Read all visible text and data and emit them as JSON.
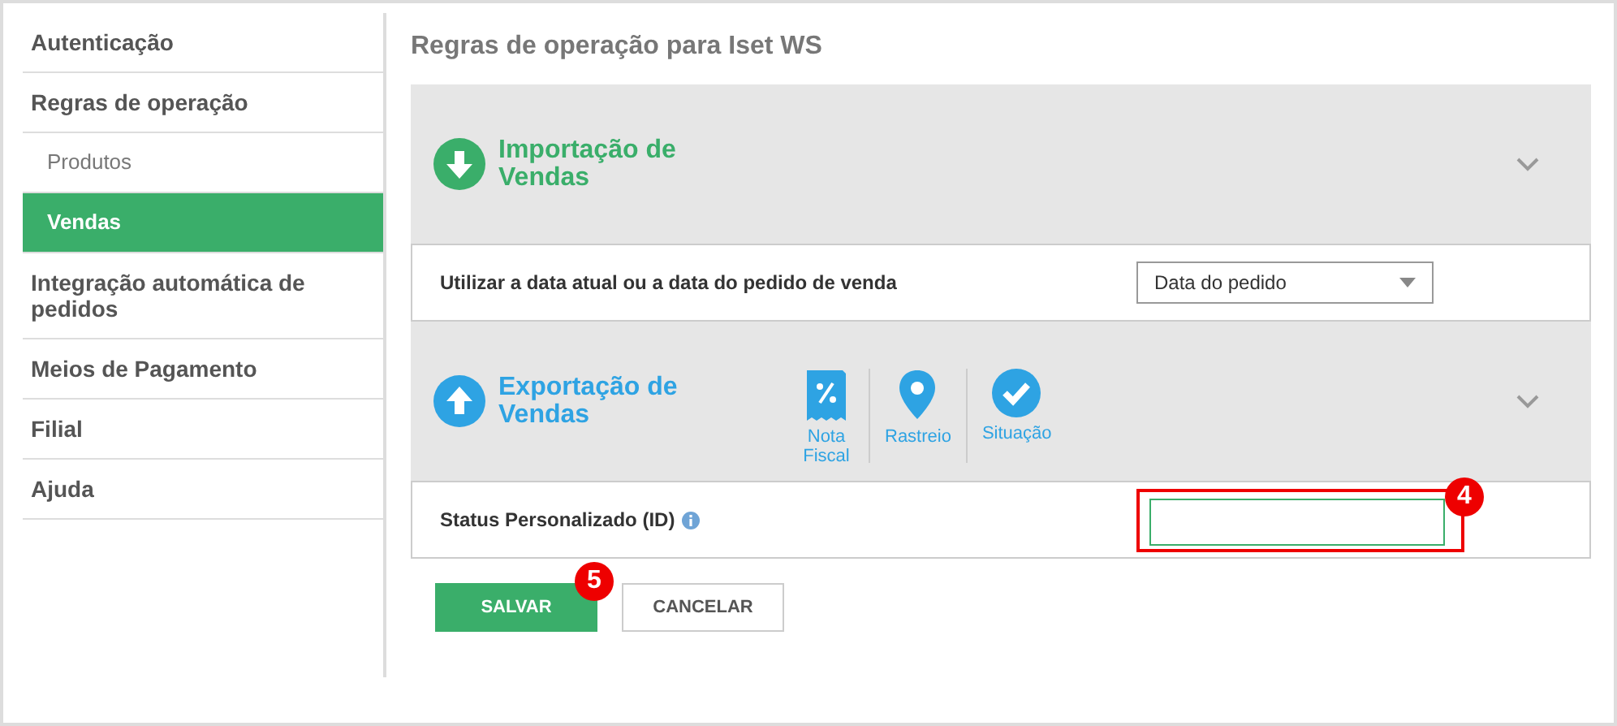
{
  "sidebar": {
    "items": [
      {
        "label": "Autenticação",
        "kind": "main",
        "selected": false
      },
      {
        "label": "Regras de operação",
        "kind": "main",
        "selected": false
      },
      {
        "label": "Produtos",
        "kind": "sub",
        "selected": false
      },
      {
        "label": "Vendas",
        "kind": "sub",
        "selected": true
      },
      {
        "label": "Integração automática de pedidos",
        "kind": "main",
        "selected": false
      },
      {
        "label": "Meios de Pagamento",
        "kind": "main",
        "selected": false
      },
      {
        "label": "Filial",
        "kind": "main",
        "selected": false
      },
      {
        "label": "Ajuda",
        "kind": "main",
        "selected": false
      }
    ]
  },
  "page_title": "Regras de operação para Iset WS",
  "sections": [
    {
      "title": "Importação de Vendas",
      "kind": "import",
      "setting": {
        "label": "Utilizar a data atual ou a data do pedido de venda",
        "kind": "select",
        "value": "Data do pedido"
      }
    },
    {
      "title": "Exportação de Vendas",
      "kind": "export",
      "shortcuts": [
        {
          "label": "Nota Fiscal",
          "kind": "invoice"
        },
        {
          "label": "Rastreio",
          "kind": "pin"
        },
        {
          "label": "Situação",
          "kind": "check"
        }
      ],
      "setting": {
        "label": "Status Personalizado (ID)",
        "kind": "text",
        "info": true,
        "callout": "4"
      }
    }
  ],
  "buttons": [
    {
      "label": "SALVAR",
      "kind": "primary",
      "callout": "5"
    },
    {
      "label": "CANCELAR",
      "kind": "secondary"
    }
  ]
}
